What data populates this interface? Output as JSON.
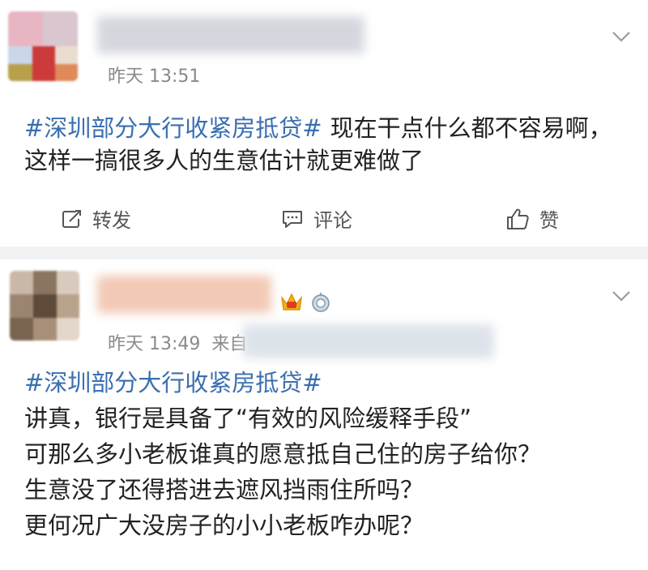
{
  "post1": {
    "time": "昨天 13:51",
    "topic": "#深圳部分大行收紧房抵贷#",
    "text": "现在干点什么都不容易啊，这样一搞很多人的生意估计就更难做了",
    "actions": {
      "repost": "转发",
      "comment": "评论",
      "like": "赞"
    }
  },
  "post2": {
    "time": "昨天 13:49",
    "source_prefix": "来自",
    "topic": "#深圳部分大行收紧房抵贷#",
    "lines": [
      "讲真，银行是具备了“有效的风险缓释手段”",
      "可那么多小老板谁真的愿意抵自己住的房子给你？",
      "生意没了还得搭进去遮风挡雨住所吗？",
      "更何况广大没房子的小小老板咋办呢？"
    ]
  },
  "colors": {
    "topic": "#3a6fb0",
    "meta": "#8a8a8a",
    "background": "#f2f2f2"
  },
  "icons": [
    "chevron-down-icon",
    "repost-icon",
    "comment-icon",
    "like-icon",
    "vip-crown-icon",
    "member-badge-icon"
  ]
}
